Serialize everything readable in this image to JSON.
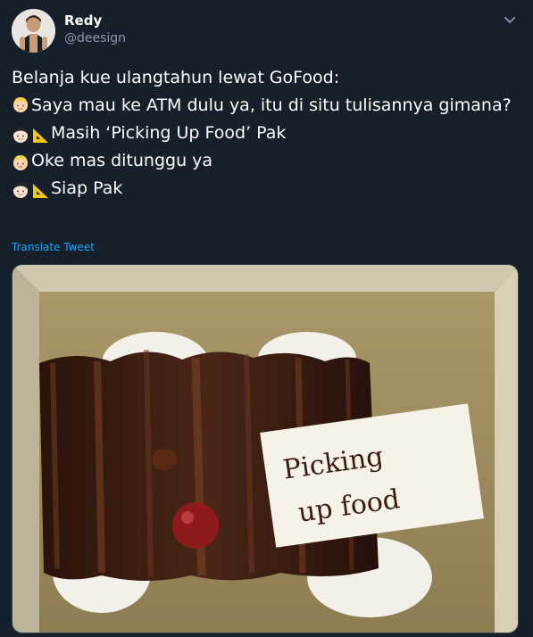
{
  "author": {
    "display_name": "Redy",
    "handle": "@deesign"
  },
  "tweet": {
    "lines": [
      "Belanja kue ulangtahun lewat GoFood:",
      "Saya mau ke ATM dulu ya, itu di situ tulisannya gimana?",
      "Masih ‘Picking Up Food’ Pak",
      "Oke mas ditunggu ya",
      "Siap Pak"
    ],
    "translate_label": "Translate Tweet"
  },
  "media": {
    "card_text_1": "Picking",
    "card_text_2": "up food"
  },
  "icons": {
    "menu": "chevron-down-icon",
    "speaker_a": "blond-person-emoji",
    "speaker_b": "person-emoji",
    "extra": "triangular-ruler-emoji"
  },
  "colors": {
    "background": "#15202b",
    "text": "#ffffff",
    "secondary": "#8899a6",
    "link": "#1da1f2"
  }
}
